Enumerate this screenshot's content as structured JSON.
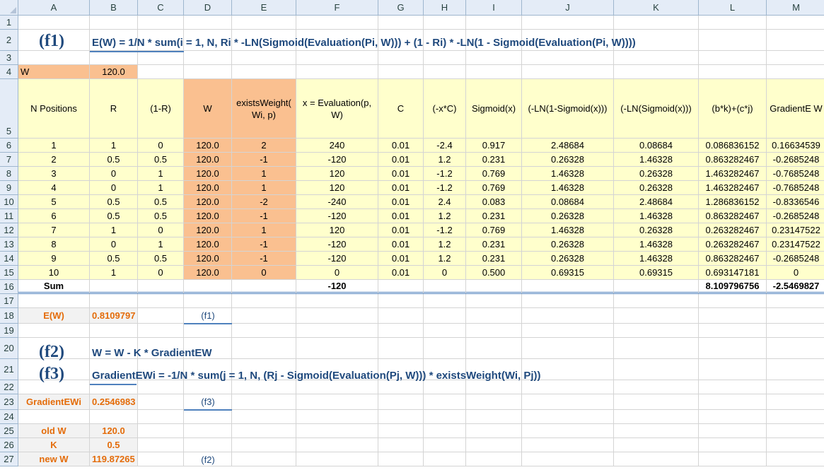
{
  "columns": [
    "A",
    "B",
    "C",
    "D",
    "E",
    "F",
    "G",
    "H",
    "I",
    "J",
    "K",
    "L",
    "M"
  ],
  "rows": [
    "1",
    "2",
    "3",
    "4",
    "5",
    "6",
    "7",
    "8",
    "9",
    "10",
    "11",
    "12",
    "13",
    "14",
    "15",
    "16",
    "17",
    "18",
    "19",
    "20",
    "21",
    "22",
    "23",
    "24",
    "25",
    "26",
    "27"
  ],
  "formulas": {
    "f1_tag": "(f1)",
    "f1": "E(W) = 1/N * sum(i = 1, N, Ri * -LN(Sigmoid(Evaluation(Pi, W))) + (1 - Ri) * -LN(1 - Sigmoid(Evaluation(Pi, W))))",
    "f2_tag": "(f2)",
    "f2": "W = W - K * GradientEW",
    "f3_tag": "(f3)",
    "f3": "GradientEWi = -1/N * sum(j = 1, N, (Rj - Sigmoid(Evaluation(Pj, W))) * existsWeight(Wi, Pj))"
  },
  "w_label": "W",
  "w_value": "120.0",
  "table": {
    "headers": [
      "N Positions",
      "R",
      "(1-R)",
      "W",
      "existsWeight( Wi, p)",
      "x = Evaluation(p, W)",
      "C",
      "(-x*C)",
      "Sigmoid(x)",
      "(-LN(1-Sigmoid(x)))",
      "(-LN(Sigmoid(x)))",
      "(b*k)+(c*j)",
      "GradientE W"
    ],
    "rows": [
      [
        "1",
        "1",
        "0",
        "120.0",
        "2",
        "240",
        "0.01",
        "-2.4",
        "0.917",
        "2.48684",
        "0.08684",
        "0.086836152",
        "0.16634539"
      ],
      [
        "2",
        "0.5",
        "0.5",
        "120.0",
        "-1",
        "-120",
        "0.01",
        "1.2",
        "0.231",
        "0.26328",
        "1.46328",
        "0.863282467",
        "-0.2685248"
      ],
      [
        "3",
        "0",
        "1",
        "120.0",
        "1",
        "120",
        "0.01",
        "-1.2",
        "0.769",
        "1.46328",
        "0.26328",
        "1.463282467",
        "-0.7685248"
      ],
      [
        "4",
        "0",
        "1",
        "120.0",
        "1",
        "120",
        "0.01",
        "-1.2",
        "0.769",
        "1.46328",
        "0.26328",
        "1.463282467",
        "-0.7685248"
      ],
      [
        "5",
        "0.5",
        "0.5",
        "120.0",
        "-2",
        "-240",
        "0.01",
        "2.4",
        "0.083",
        "0.08684",
        "2.48684",
        "1.286836152",
        "-0.8336546"
      ],
      [
        "6",
        "0.5",
        "0.5",
        "120.0",
        "-1",
        "-120",
        "0.01",
        "1.2",
        "0.231",
        "0.26328",
        "1.46328",
        "0.863282467",
        "-0.2685248"
      ],
      [
        "7",
        "1",
        "0",
        "120.0",
        "1",
        "120",
        "0.01",
        "-1.2",
        "0.769",
        "1.46328",
        "0.26328",
        "0.263282467",
        "0.23147522"
      ],
      [
        "8",
        "0",
        "1",
        "120.0",
        "-1",
        "-120",
        "0.01",
        "1.2",
        "0.231",
        "0.26328",
        "1.46328",
        "0.263282467",
        "0.23147522"
      ],
      [
        "9",
        "0.5",
        "0.5",
        "120.0",
        "-1",
        "-120",
        "0.01",
        "1.2",
        "0.231",
        "0.26328",
        "1.46328",
        "0.863282467",
        "-0.2685248"
      ],
      [
        "10",
        "1",
        "0",
        "120.0",
        "0",
        "0",
        "0.01",
        "0",
        "0.500",
        "0.69315",
        "0.69315",
        "0.693147181",
        "0"
      ]
    ],
    "sum_label": "Sum",
    "sum_f": "-120",
    "sum_l": "8.109796756",
    "sum_m": "-2.5469827"
  },
  "results": {
    "ew_label": "E(W)",
    "ew_value": "0.8109797",
    "ew_ref": "(f1)",
    "grad_label": "GradientEWi",
    "grad_value": "0.2546983",
    "grad_ref": "(f3)",
    "oldw_label": "old W",
    "oldw_value": "120.0",
    "k_label": "K",
    "k_value": "0.5",
    "neww_label": "new W",
    "neww_value": "119.87265",
    "neww_ref": "(f2)"
  },
  "colors": {
    "yellow": "#ffffcc",
    "orange": "#fac090",
    "header": "#e4ecf7",
    "formula": "#1f497d",
    "label": "#e46c0a"
  }
}
